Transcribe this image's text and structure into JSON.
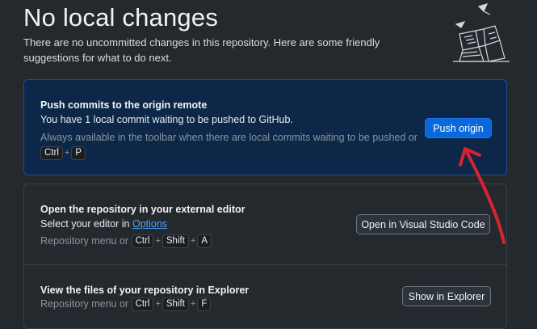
{
  "header": {
    "title": "No local changes",
    "subtitle": "There are no uncommitted changes in this repository. Here are some friendly suggestions for what to do next."
  },
  "push_card": {
    "title": "Push commits to the origin remote",
    "description": "You have 1 local commit waiting to be pushed to GitHub.",
    "hint": "Always available in the toolbar when there are local commits waiting to be pushed or",
    "shortcut": [
      "Ctrl",
      "P"
    ],
    "button_label": "Push origin"
  },
  "editor_card": {
    "title": "Open the repository in your external editor",
    "description_prefix": "Select your editor in",
    "options_link": "Options",
    "hint": "Repository menu or",
    "shortcut": [
      "Ctrl",
      "Shift",
      "A"
    ],
    "button_label": "Open in Visual Studio Code"
  },
  "explorer_card": {
    "title": "View the files of your repository in Explorer",
    "hint": "Repository menu or",
    "shortcut": [
      "Ctrl",
      "Shift",
      "F"
    ],
    "button_label": "Show in Explorer"
  },
  "colors": {
    "background": "#24292e",
    "accent": "#0969da",
    "annotation_arrow": "#d9232e"
  },
  "icons": [
    "paper-crane-illustration",
    "annotation-arrow"
  ]
}
